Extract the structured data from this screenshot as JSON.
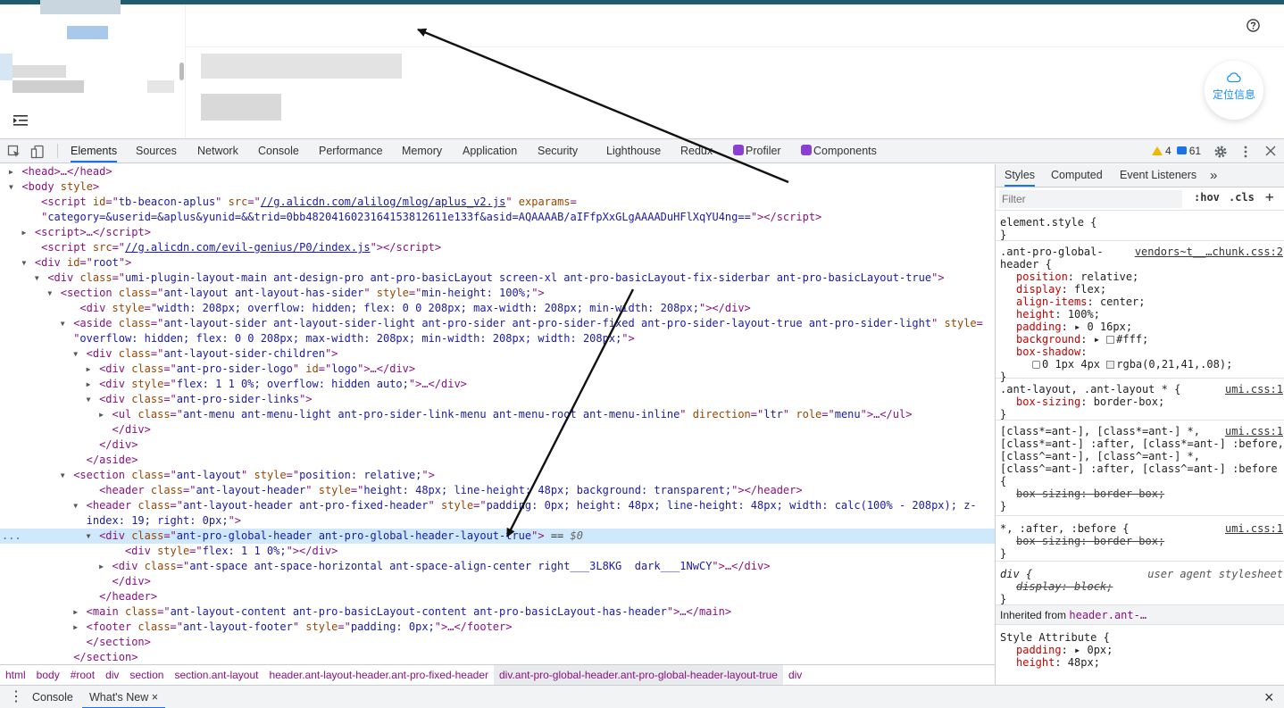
{
  "page": {
    "locate_label": "定位信息",
    "help_icon": "question-circle-icon",
    "sider_toggle_icon": "menu-fold-icon"
  },
  "devtools": {
    "tabs": [
      "Elements",
      "Sources",
      "Network",
      "Console",
      "Performance",
      "Memory",
      "Application",
      "Security",
      "Lighthouse",
      "Redux",
      "Profiler",
      "Components"
    ],
    "active_tab": "Elements",
    "warnings_count": "4",
    "messages_count": "61",
    "accent_color": "#1a73e8",
    "dom_lines": [
      {
        "indent": 2,
        "tri": "▶",
        "html": "<span class=\"mono\">&lt;head&gt;…&lt;/head&gt;</span>"
      },
      {
        "indent": 2,
        "tri": "▼",
        "html": "&lt;body <span style=\"color:#994500\">style</span>&gt;"
      },
      {
        "indent": 5,
        "tri": "",
        "html": "&lt;script <span style=\"color:#994500\">id</span>=\"<span style=\"color:#1a1aa6\">tb-beacon-aplus</span>\" <span style=\"color:#994500\">src</span>=\"<span style=\"color:#1a1aa6;text-decoration:underline\">//g.alicdn.com/alilog/mlog/aplus_v2.js</span>\" <span style=\"color:#994500\">exparams</span>="
      },
      {
        "indent": 5,
        "tri": "",
        "html": "\"<span style=\"color:#1a1aa6\">category=&amp;userid=&amp;aplus&amp;yunid=&amp;&amp;trid=0bb4820416023164153812611e133f&amp;asid=AQAAAAB/aIFfpXxGLgAAAADuHFlXqYU4ng==</span>\"&gt;&lt;/script&gt;"
      },
      {
        "indent": 4,
        "tri": "▶",
        "html": "&lt;script&gt;…&lt;/script&gt;"
      },
      {
        "indent": 5,
        "tri": "",
        "html": "&lt;script <span style=\"color:#994500\">src</span>=\"<span style=\"color:#1a1aa6;text-decoration:underline\">//g.alicdn.com/evil-genius/P0/index.js</span>\"&gt;&lt;/script&gt;"
      },
      {
        "indent": 4,
        "tri": "▼",
        "html": "&lt;div <span style=\"color:#994500\">id</span>=\"<span style=\"color:#1a1aa6\">root</span>\"&gt;"
      },
      {
        "indent": 6,
        "tri": "▼",
        "html": "&lt;div <span style=\"color:#994500\">class</span>=\"<span style=\"color:#1a1aa6\">umi-plugin-layout-main ant-design-pro ant-pro-basicLayout screen-xl ant-pro-basicLayout-fix-siderbar ant-pro-basicLayout-true</span>\"&gt;"
      },
      {
        "indent": 8,
        "tri": "▼",
        "html": "&lt;section <span style=\"color:#994500\">class</span>=\"<span style=\"color:#1a1aa6\">ant-layout ant-layout-has-sider</span>\" <span style=\"color:#994500\">style</span>=\"<span style=\"color:#1a1aa6\">min-height: 100%;</span>\"&gt;"
      },
      {
        "indent": 11,
        "tri": "",
        "html": "&lt;div <span style=\"color:#994500\">style</span>=\"<span style=\"color:#1a1aa6\">width: 208px; overflow: hidden; flex: 0 0 208px; max-width: 208px; min-width: 208px;</span>\"&gt;&lt;/div&gt;"
      },
      {
        "indent": 10,
        "tri": "▼",
        "html": "&lt;aside <span style=\"color:#994500\">class</span>=\"<span style=\"color:#1a1aa6\">ant-layout-sider ant-layout-sider-light ant-pro-sider ant-pro-sider-fixed ant-pro-sider-layout-true ant-pro-sider-light</span>\" <span style=\"color:#994500\">style</span>="
      },
      {
        "indent": 10,
        "tri": "",
        "html": "\"<span style=\"color:#1a1aa6\">overflow: hidden; flex: 0 0 208px; max-width: 208px; min-width: 208px; width: 208px;</span>\"&gt;"
      },
      {
        "indent": 12,
        "tri": "▼",
        "html": "&lt;div <span style=\"color:#994500\">class</span>=\"<span style=\"color:#1a1aa6\">ant-layout-sider-children</span>\"&gt;"
      },
      {
        "indent": 14,
        "tri": "▶",
        "html": "&lt;div <span style=\"color:#994500\">class</span>=\"<span style=\"color:#1a1aa6\">ant-pro-sider-logo</span>\" <span style=\"color:#994500\">id</span>=\"<span style=\"color:#1a1aa6\">logo</span>\"&gt;…&lt;/div&gt;"
      },
      {
        "indent": 14,
        "tri": "▶",
        "html": "&lt;div <span style=\"color:#994500\">style</span>=\"<span style=\"color:#1a1aa6\">flex: 1 1 0%; overflow: hidden auto;</span>\"&gt;…&lt;/div&gt;"
      },
      {
        "indent": 14,
        "tri": "▼",
        "html": "&lt;div <span style=\"color:#994500\">class</span>=\"<span style=\"color:#1a1aa6\">ant-pro-sider-links</span>\"&gt;"
      },
      {
        "indent": 16,
        "tri": "▶",
        "html": "&lt;ul <span style=\"color:#994500\">class</span>=\"<span style=\"color:#1a1aa6\">ant-menu ant-menu-light ant-pro-sider-link-menu ant-menu-root ant-menu-inline</span>\" <span style=\"color:#994500\">direction</span>=\"<span style=\"color:#1a1aa6\">ltr</span>\" <span style=\"color:#994500\">role</span>=\"<span style=\"color:#1a1aa6\">menu</span>\"&gt;…&lt;/ul&gt;"
      },
      {
        "indent": 16,
        "tri": "",
        "html": "&lt;/div&gt;"
      },
      {
        "indent": 14,
        "tri": "",
        "html": "&lt;/div&gt;"
      },
      {
        "indent": 12,
        "tri": "",
        "html": "&lt;/aside&gt;"
      },
      {
        "indent": 10,
        "tri": "▼",
        "html": "&lt;section <span style=\"color:#994500\">class</span>=\"<span style=\"color:#1a1aa6\">ant-layout</span>\" <span style=\"color:#994500\">style</span>=\"<span style=\"color:#1a1aa6\">position: relative;</span>\"&gt;"
      },
      {
        "indent": 14,
        "tri": "",
        "html": "&lt;header <span style=\"color:#994500\">class</span>=\"<span style=\"color:#1a1aa6\">ant-layout-header</span>\" <span style=\"color:#994500\">style</span>=\"<span style=\"color:#1a1aa6\">height: 48px; line-height: 48px; background: transparent;</span>\"&gt;&lt;/header&gt;"
      },
      {
        "indent": 12,
        "tri": "▼",
        "html": "&lt;header <span style=\"color:#994500\">class</span>=\"<span style=\"color:#1a1aa6\">ant-layout-header ant-pro-fixed-header</span>\" <span style=\"color:#994500\">style</span>=\"<span style=\"color:#1a1aa6\">padding: 0px; height: 48px; line-height: 48px; width: calc(100% - 208px); z-</span>"
      },
      {
        "indent": 12,
        "tri": "",
        "html": "<span style=\"color:#1a1aa6\">index: 19; right: 0px;</span>\"&gt;"
      },
      {
        "indent": 14,
        "tri": "▼",
        "html": "&lt;div <span style=\"color:#994500\">class</span>=\"<span style=\"color:#1a1aa6\">ant-pro-global-header ant-pro-global-header-layout-true</span>\"&gt; <span style=\"color:#333\">== </span><span style=\"color:#666;font-style:italic\">$0</span>",
        "selected": true
      },
      {
        "indent": 18,
        "tri": "",
        "html": "&lt;div <span style=\"color:#994500\">style</span>=\"<span style=\"color:#1a1aa6\">flex: 1 1 0%;</span>\"&gt;&lt;/div&gt;"
      },
      {
        "indent": 16,
        "tri": "▶",
        "html": "&lt;div <span style=\"color:#994500\">class</span>=\"<span style=\"color:#1a1aa6\">ant-space ant-space-horizontal ant-space-align-center right___3L8KG  dark___1NwCY</span>\"&gt;…&lt;/div&gt;"
      },
      {
        "indent": 16,
        "tri": "",
        "html": "&lt;/div&gt;"
      },
      {
        "indent": 14,
        "tri": "",
        "html": "&lt;/header&gt;"
      },
      {
        "indent": 12,
        "tri": "▶",
        "html": "&lt;main <span style=\"color:#994500\">class</span>=\"<span style=\"color:#1a1aa6\">ant-layout-content ant-pro-basicLayout-content ant-pro-basicLayout-has-header</span>\"&gt;…&lt;/main&gt;"
      },
      {
        "indent": 12,
        "tri": "▶",
        "html": "&lt;footer <span style=\"color:#994500\">class</span>=\"<span style=\"color:#1a1aa6\">ant-layout-footer</span>\" <span style=\"color:#994500\">style</span>=\"<span style=\"color:#1a1aa6\">padding: 0px;</span>\"&gt;…&lt;/footer&gt;"
      },
      {
        "indent": 12,
        "tri": "",
        "html": "&lt;/section&gt;"
      },
      {
        "indent": 10,
        "tri": "",
        "html": "&lt;/section&gt;"
      }
    ],
    "selected_marker": "...",
    "breadcrumbs": [
      "html",
      "body",
      "#root",
      "div",
      "section",
      "section.ant-layout",
      "header.ant-layout-header.ant-pro-fixed-header",
      "div.ant-pro-global-header.ant-pro-global-header-layout-true",
      "div"
    ],
    "breadcrumb_selected_index": 7
  },
  "styles": {
    "tabs": [
      "Styles",
      "Computed",
      "Event Listeners"
    ],
    "more_tabs": "»",
    "filter_placeholder": "Filter",
    "hov": ":hov",
    "cls": ".cls",
    "add": "+",
    "element_style_open": "element.style {",
    "close_brace": "}",
    "rule1_selector_a": ".ant-pro-global-",
    "rule1_selector_b": "header {",
    "rule1_source": "vendors~t__…chunk.css:2",
    "rule1_props": [
      {
        "name": "position",
        "value": "relative;"
      },
      {
        "name": "display",
        "value": "flex;"
      },
      {
        "name": "align-items",
        "value": "center;"
      },
      {
        "name": "height",
        "value": "100%;"
      },
      {
        "name": "padding",
        "value": "▸ 0 16px;"
      },
      {
        "name": "background",
        "value": "▸ #fff;"
      },
      {
        "name": "box-shadow",
        "value": ""
      }
    ],
    "rule1_shadow_value": "0 1px 4px ",
    "rule1_shadow_color": "rgba(0,21,41,.08);",
    "rule2_selector": ".ant-layout, .ant-layout * {",
    "rule2_source": "umi.css:1",
    "rule2_prop": "box-sizing",
    "rule2_value": "border-box;",
    "rule3_lines": [
      "[class*=ant-], [class*=ant-] *,",
      "[class*=ant-] :after, [class*=ant-] :before,",
      "[class^=ant-], [class^=ant-] *,",
      "[class^=ant-] :after, [class^=ant-] :before",
      "{"
    ],
    "rule3_source": "umi.css:1",
    "rule3_prop": "box-sizing: border-box;",
    "rule4_selector": "*, :after, :before {",
    "rule4_source": "umi.css:1",
    "rule4_prop": "box-sizing: border-box;",
    "rule5_selector": "div {",
    "rule5_source": "user agent stylesheet",
    "rule5_prop": "display: block;",
    "inherited_label": "Inherited from ",
    "inherited_from": "header.ant-…",
    "style_attr_open": "Style Attribute {",
    "style_attr_props": [
      {
        "name": "padding",
        "value": "▸ 0px;"
      },
      {
        "name": "height",
        "value": "48px;"
      }
    ]
  },
  "drawer": {
    "more_icon": "⋮",
    "tabs": [
      "Console",
      "What's New"
    ],
    "active_tab": "What's New",
    "tab_close": "×",
    "close_icon": "×"
  }
}
